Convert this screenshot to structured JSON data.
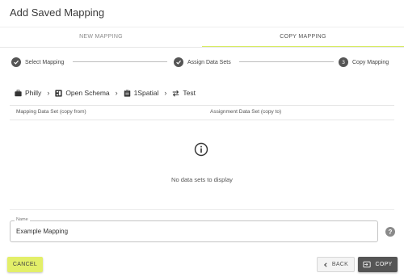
{
  "dialog": {
    "title": "Add Saved Mapping"
  },
  "tabs": [
    {
      "label": "NEW MAPPING",
      "active": false
    },
    {
      "label": "COPY MAPPING",
      "active": true
    }
  ],
  "stepper": {
    "steps": [
      {
        "label": "Select Mapping",
        "state": "complete",
        "icon": "check-icon"
      },
      {
        "label": "Assign Data Sets",
        "state": "complete",
        "icon": "check-icon"
      },
      {
        "label": "Copy Mapping",
        "state": "active",
        "number": "3"
      }
    ]
  },
  "breadcrumb": [
    {
      "label": "Philly",
      "icon": "briefcase-icon"
    },
    {
      "label": "Open Schema",
      "icon": "schema-icon"
    },
    {
      "label": "1Spatial",
      "icon": "clipboard-icon"
    },
    {
      "label": "Test",
      "icon": "swap-arrows-icon"
    }
  ],
  "table": {
    "columns": [
      "Mapping Data Set (copy from)",
      "Assignment Data Set (copy to)"
    ],
    "rows": [],
    "empty_message": "No data sets to display"
  },
  "name_field": {
    "legend": "Name",
    "value": "Example Mapping"
  },
  "actions": {
    "cancel": "CANCEL",
    "back": "BACK",
    "copy": "COPY"
  },
  "colors": {
    "accent": "#d8ec62",
    "cancel_button": "#e3ef69",
    "copy_button": "#555555",
    "step_circle": "#555555"
  }
}
